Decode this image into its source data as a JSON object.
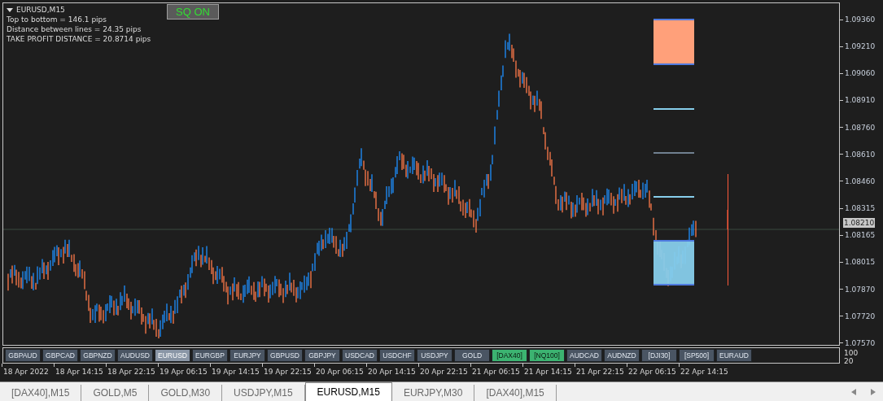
{
  "chart_title": "EURUSD,M15",
  "info_lines": [
    "Top to bottom = 146.1 pips",
    "Distance between lines = 24.35 pips",
    "TAKE PROFIT DISTANCE = 20.8714 pips"
  ],
  "sq_button": {
    "label": "SQ ON",
    "on": true
  },
  "price_scale": [
    "1.09360",
    "1.09210",
    "1.09060",
    "1.08910",
    "1.08760",
    "1.08610",
    "1.08460",
    "1.08315",
    "1.08165",
    "1.08015",
    "1.07870",
    "1.07720",
    "1.07570"
  ],
  "current_price": "1.08210",
  "symbol_buttons": [
    {
      "label": "GBPAUD",
      "selected": false,
      "highlighted": false
    },
    {
      "label": "GBPCAD",
      "selected": false,
      "highlighted": false
    },
    {
      "label": "GBPNZD",
      "selected": false,
      "highlighted": false
    },
    {
      "label": "AUDUSD",
      "selected": false,
      "highlighted": false
    },
    {
      "label": "EURUSD",
      "selected": true,
      "highlighted": false
    },
    {
      "label": "EURGBP",
      "selected": false,
      "highlighted": false
    },
    {
      "label": "EURJPY",
      "selected": false,
      "highlighted": false
    },
    {
      "label": "GBPUSD",
      "selected": false,
      "highlighted": false
    },
    {
      "label": "GBPJPY",
      "selected": false,
      "highlighted": false
    },
    {
      "label": "USDCAD",
      "selected": false,
      "highlighted": false
    },
    {
      "label": "USDCHF",
      "selected": false,
      "highlighted": false
    },
    {
      "label": "USDJPY",
      "selected": false,
      "highlighted": false
    },
    {
      "label": "GOLD",
      "selected": false,
      "highlighted": false
    },
    {
      "label": "[DAX40]",
      "selected": false,
      "highlighted": true
    },
    {
      "label": "[NQ100]",
      "selected": false,
      "highlighted": true
    },
    {
      "label": "AUDCAD",
      "selected": false,
      "highlighted": false
    },
    {
      "label": "AUDNZD",
      "selected": false,
      "highlighted": false
    },
    {
      "label": "[DJI30]",
      "selected": false,
      "highlighted": false
    },
    {
      "label": "[SP500]",
      "selected": false,
      "highlighted": false
    },
    {
      "label": "EURAUD",
      "selected": false,
      "highlighted": false
    }
  ],
  "indicator_scale": [
    "100",
    "20"
  ],
  "time_axis": [
    "18 Apr 2022",
    "18 Apr 14:15",
    "18 Apr 22:15",
    "19 Apr 06:15",
    "19 Apr 14:15",
    "19 Apr 22:15",
    "20 Apr 06:15",
    "20 Apr 14:15",
    "20 Apr 22:15",
    "21 Apr 06:15",
    "21 Apr 14:15",
    "21 Apr 22:15",
    "22 Apr 06:15",
    "22 Apr 14:15"
  ],
  "tabs": [
    {
      "label": "[DAX40],M15",
      "selected": false
    },
    {
      "label": "GOLD,M5",
      "selected": false
    },
    {
      "label": "GOLD,M30",
      "selected": false
    },
    {
      "label": "USDJPY,M15",
      "selected": false
    },
    {
      "label": "EURUSD,M15",
      "selected": true
    },
    {
      "label": "EURJPY,M30",
      "selected": false
    },
    {
      "label": "[DAX40],M15",
      "selected": false
    }
  ]
}
